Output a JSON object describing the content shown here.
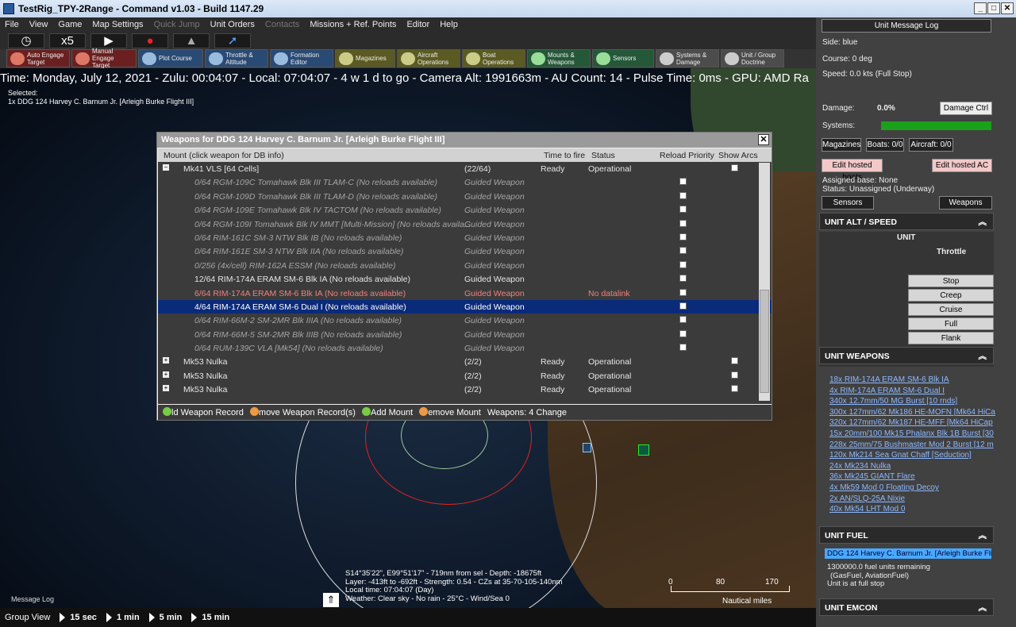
{
  "window": {
    "title": "TestRig_TPY-2Range - Command v1.03 - Build 1147.29"
  },
  "menu": [
    "File",
    "View",
    "Game",
    "Map Settings",
    "Quick Jump",
    "Unit Orders",
    "Contacts",
    "Missions + Ref. Points",
    "Editor",
    "Help"
  ],
  "time_controls": {
    "compression": "x5"
  },
  "toolbar": [
    {
      "label": "Auto Engage Target",
      "style": "red",
      "icon": "target-icon"
    },
    {
      "label": "Manual Engage Target",
      "style": "red",
      "icon": "target-icon"
    },
    {
      "label": "Plot Course",
      "style": "blue",
      "icon": "course-icon"
    },
    {
      "label": "Throttle & Altitude",
      "style": "blue",
      "icon": "throttle-icon"
    },
    {
      "label": "Formation Editor",
      "style": "blue",
      "icon": "formation-icon"
    },
    {
      "label": "Magazines",
      "style": "olive",
      "icon": "magazine-icon"
    },
    {
      "label": "Aircraft Operations",
      "style": "olive",
      "icon": "aircraft-icon"
    },
    {
      "label": "Boat Operations",
      "style": "olive",
      "icon": "boat-icon"
    },
    {
      "label": "Mounts & Weapons",
      "style": "grn",
      "icon": "weapons-icon"
    },
    {
      "label": "Sensors",
      "style": "grn",
      "icon": "sensor-icon"
    },
    {
      "label": "Systems & Damage",
      "style": "gray",
      "icon": "gear-icon"
    },
    {
      "label": "Unit / Group Doctrine",
      "style": "gray",
      "icon": "doctrine-icon"
    }
  ],
  "status_line": "Time: Monday, July 12, 2021 - Zulu: 00:04:07 - Local: 07:04:07 - 4 w 1 d to go -  Camera Alt: 1991663m  - AU Count: 14 - Pulse Time: 0ms - GPU: AMD Ra",
  "selected": {
    "label": "Selected:",
    "unit": "1x DDG 124 Harvey C. Barnum Jr. [Arleigh Burke Flight III]"
  },
  "dialog": {
    "title": "Weapons for DDG 124 Harvey C. Barnum Jr. [Arleigh Burke Flight III]",
    "columns": {
      "mount": "Mount (click weapon for DB info)",
      "time": "Time to fire",
      "status": "Status",
      "reload": "Reload Priority",
      "arcs": "Show Arcs"
    },
    "rows": [
      {
        "kind": "mount",
        "name": "Mk41 VLS [64 Cells]",
        "qty": "(22/64)",
        "time": "Ready",
        "status": "Operational",
        "expander": "−"
      },
      {
        "kind": "dim",
        "name": "0/64 RGM-109C Tomahawk Blk III TLAM-C (No reloads available)",
        "type": "Guided Weapon",
        "status": ""
      },
      {
        "kind": "dim",
        "name": "0/64 RGM-109D Tomahawk Blk III TLAM-D (No reloads available)",
        "type": "Guided Weapon",
        "status": ""
      },
      {
        "kind": "dim",
        "name": "0/64 RGM-109E Tomahawk Blk IV TACTOM (No reloads available)",
        "type": "Guided Weapon",
        "status": ""
      },
      {
        "kind": "dim",
        "name": "0/64 RGM-109I Tomahawk Blk IV MMT [Multi-Mission] (No reloads availa...",
        "type": "Guided Weapon",
        "status": ""
      },
      {
        "kind": "dim",
        "name": "0/64 RIM-161C SM-3 NTW Blk IB (No reloads available)",
        "type": "Guided Weapon",
        "status": ""
      },
      {
        "kind": "dim",
        "name": "0/64 RIM-161E SM-3 NTW Blk IIA (No reloads available)",
        "type": "Guided Weapon",
        "status": ""
      },
      {
        "kind": "dim",
        "name": "0/256 (4x/cell) RIM-162A ESSM (No reloads available)",
        "type": "Guided Weapon",
        "status": ""
      },
      {
        "kind": "normal",
        "name": "12/64 RIM-174A ERAM SM-6 Blk IA (No reloads available)",
        "type": "Guided Weapon",
        "status": ""
      },
      {
        "kind": "red",
        "name": "6/64 RIM-174A ERAM SM-6 Blk IA (No reloads available)",
        "type": "Guided Weapon",
        "status": "No datalink"
      },
      {
        "kind": "sel",
        "name": "4/64 RIM-174A ERAM SM-6 Dual I (No reloads available)",
        "type": "Guided Weapon",
        "status": ""
      },
      {
        "kind": "dim",
        "name": "0/64 RIM-66M-2 SM-2MR Blk IIIA (No reloads available)",
        "type": "Guided Weapon",
        "status": ""
      },
      {
        "kind": "dim",
        "name": "0/64 RIM-66M-5 SM-2MR Blk IIIB (No reloads available)",
        "type": "Guided Weapon",
        "status": ""
      },
      {
        "kind": "dim",
        "name": "0/64 RUM-139C VLA [Mk54] (No reloads available)",
        "type": "Guided Weapon",
        "status": ""
      },
      {
        "kind": "mount",
        "name": "Mk53 Nulka",
        "qty": "(2/2)",
        "time": "Ready",
        "status": "Operational",
        "expander": "+"
      },
      {
        "kind": "mount",
        "name": "Mk53 Nulka",
        "qty": "(2/2)",
        "time": "Ready",
        "status": "Operational",
        "expander": "+"
      },
      {
        "kind": "mount",
        "name": "Mk53 Nulka",
        "qty": "(2/2)",
        "time": "Ready",
        "status": "Operational",
        "expander": "+"
      }
    ],
    "footer": {
      "add_weapon": "ld Weapon Record",
      "remove_weapon": "move Weapon Record(s)",
      "add_mount": "Add Mount",
      "remove_mount": "emove Mount",
      "weapons": "Weapons:  4  Change"
    }
  },
  "right_panel": {
    "log_button": "Unit Message Log",
    "side": "Side: blue",
    "course": "Course: 0 deg",
    "speed": "Speed: 0.0 kts (Full Stop)",
    "damage_label": "Damage:",
    "damage_value": "0.0%",
    "damage_ctrl": "Damage Ctrl",
    "systems_label": "Systems:",
    "magazines": "Magazines",
    "boats": "Boats: 0/0",
    "aircraft": "Aircraft: 0/0",
    "edit_boats": "Edit hosted boats",
    "edit_ac": "Edit hosted AC",
    "assigned_base": "Assigned base: None",
    "status": "Status: Unassigned (Underway)",
    "sensors_btn": "Sensors",
    "weapons_btn": "Weapons",
    "alt_speed_header": "UNIT ALT / SPEED",
    "unit_label": "UNIT",
    "throttle_label": "Throttle",
    "throttle": [
      "Stop",
      "Creep",
      "Cruise",
      "Full",
      "Flank"
    ],
    "weapons_header": "UNIT WEAPONS",
    "weapons": [
      "18x RIM-174A ERAM SM-6 Blk IA",
      "4x RIM-174A ERAM SM-6 Dual I",
      "340x 12.7mm/50 MG Burst [10 rnds]",
      "300x 127mm/62 Mk186 HE-MOFN [Mk64 HiCa",
      "320x 127mm/62 Mk187 HE-MFF [Mk64 HiCap",
      "15x 20mm/100 Mk15 Phalanx Blk 1B Burst [30",
      "228x 25mm/75 Bushmaster Mod 2 Burst [12 m",
      "120x Mk214 Sea Gnat Chaff [Seduction]",
      "24x Mk234 Nulka",
      "36x Mk245 GIANT Flare",
      "4x Mk59 Mod 0 Floating Decoy",
      "2x AN/SLQ-25A Nixie",
      "40x Mk54 LHT Mod 0"
    ],
    "fuel_header": "UNIT FUEL",
    "fuel_unit": "DDG 124 Harvey C. Barnum Jr. [Arleigh Burke Fli",
    "fuel_lines": [
      "1300000.0 fuel units remaining",
      "(GasFuel, AviationFuel)",
      "Unit is at full stop"
    ],
    "emcon_header": "UNIT EMCON"
  },
  "map": {
    "hover": [
      "S14°35'22\", E99°51'17\" - 719nm from sel - Depth: -18675ft",
      "Layer: -413ft to -692ft - Strength: 0.54 - CZs at 35-70-105-140nm",
      "Local time: 07:04:07 (Day)",
      "Weather: Clear sky - No rain - 25°C - Wind/Sea 0"
    ],
    "scale_ticks": [
      "0",
      "80",
      "170"
    ],
    "scale_unit": "Nautical miles",
    "message_log": "Message Log"
  },
  "group_bar": {
    "label": "Group View",
    "steps": [
      "15 sec",
      "1 min",
      "5 min",
      "15 min"
    ]
  }
}
